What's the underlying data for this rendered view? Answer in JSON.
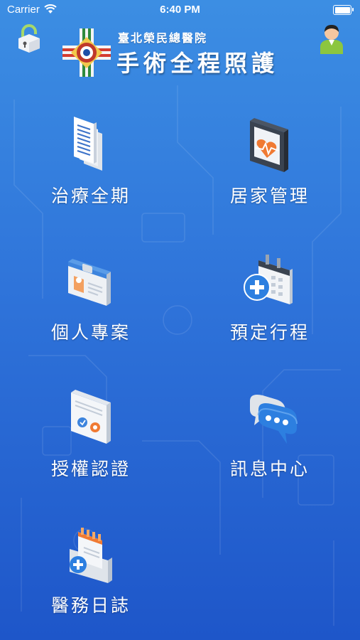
{
  "status_bar": {
    "carrier": "Carrier",
    "time": "6:40 PM"
  },
  "header": {
    "hospital_name": "臺北榮民總醫院",
    "app_title": "手術全程照護",
    "lock_icon": "lock-icon",
    "user_icon": "user-profile-icon",
    "logo_icon": "hospital-emblem-icon"
  },
  "menu": {
    "items": [
      {
        "label": "治療全期",
        "icon": "document-stack-icon"
      },
      {
        "label": "居家管理",
        "icon": "heart-tablet-icon"
      },
      {
        "label": "個人專案",
        "icon": "id-card-icon"
      },
      {
        "label": "預定行程",
        "icon": "calendar-medical-icon"
      },
      {
        "label": "授權認證",
        "icon": "authorization-document-icon"
      },
      {
        "label": "訊息中心",
        "icon": "chat-bubbles-icon"
      },
      {
        "label": "醫務日誌",
        "icon": "medical-journal-icon"
      }
    ]
  },
  "colors": {
    "background_top": "#3c8ee3",
    "background_bottom": "#1e56c9",
    "accent_orange": "#f08a3c",
    "accent_blue": "#2d7fe0"
  }
}
